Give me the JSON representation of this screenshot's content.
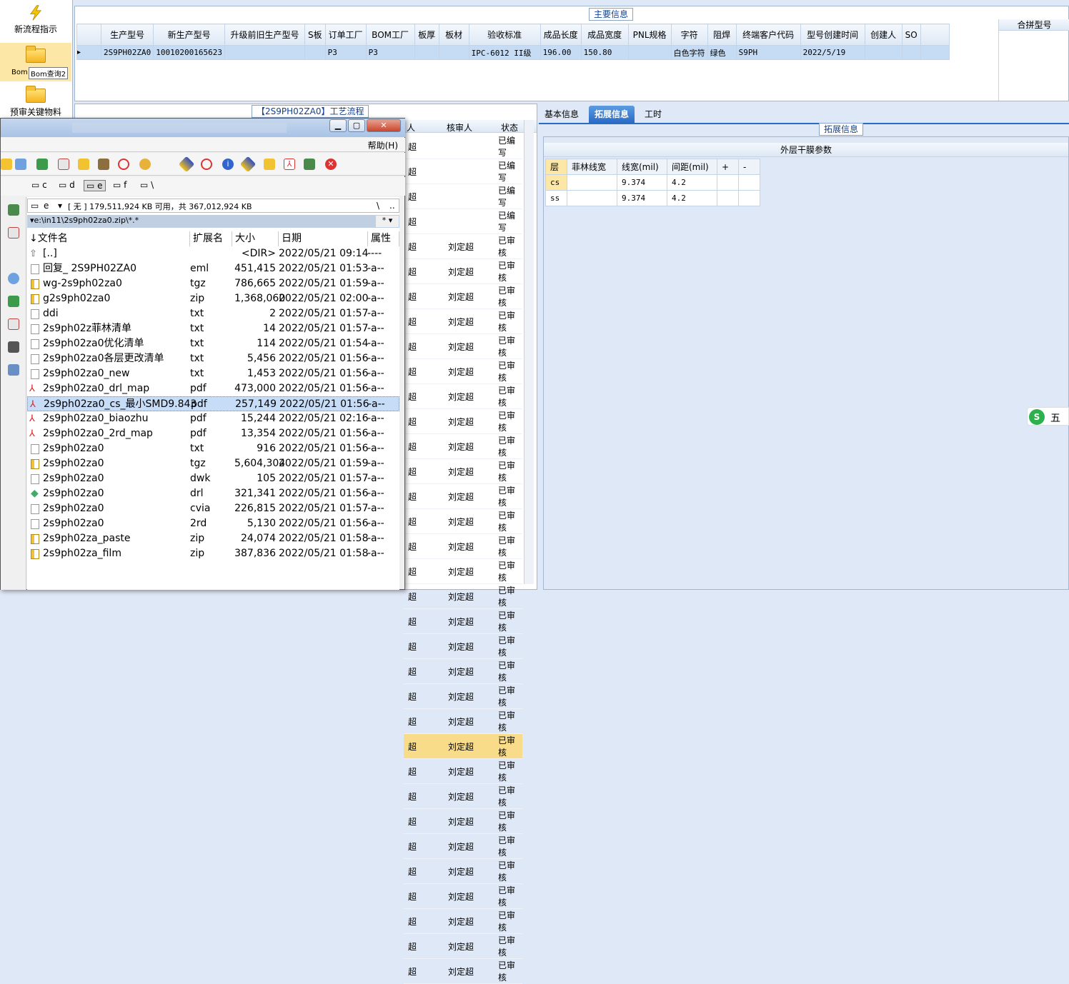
{
  "leftnav": {
    "items": [
      {
        "label": "新流程指示"
      },
      {
        "label": "Bom查询2",
        "tooltip": "Bom查询2",
        "short": "Bom"
      },
      {
        "label": "预审关键物料"
      }
    ]
  },
  "main": {
    "title": "主要信息",
    "columns": [
      "生产型号",
      "新生产型号",
      "升级前旧生产型号",
      "S板",
      "订单工厂",
      "BOM工厂",
      "板厚",
      "板材",
      "验收标准",
      "成品长度",
      "成品宽度",
      "PNL规格",
      "字符",
      "阻焊",
      "终端客户代码",
      "型号创建时间",
      "创建人",
      "SO"
    ],
    "row": [
      "2S9PH02ZA0",
      "10010200165623",
      "",
      "",
      "P3",
      "P3",
      "",
      "",
      "IPC-6012 II级",
      "196.00",
      "150.80",
      "",
      "白色字符",
      "绿色",
      "S9PH",
      "2022/5/19",
      "",
      ""
    ],
    "right_header": "合拼型号"
  },
  "process": {
    "title": "【2S9PH02ZA0】工艺流程",
    "col_reviewer": "核审人",
    "col_status": "状态",
    "rows": [
      {
        "a": "超",
        "r": "",
        "s": "已编写"
      },
      {
        "a": "超",
        "r": "",
        "s": "已编写"
      },
      {
        "a": "超",
        "r": "",
        "s": "已编写"
      },
      {
        "a": "超",
        "r": "",
        "s": "已编写"
      },
      {
        "a": "超",
        "r": "刘定超",
        "s": "已审核"
      },
      {
        "a": "超",
        "r": "刘定超",
        "s": "已审核"
      },
      {
        "a": "超",
        "r": "刘定超",
        "s": "已审核"
      },
      {
        "a": "超",
        "r": "刘定超",
        "s": "已审核"
      },
      {
        "a": "超",
        "r": "刘定超",
        "s": "已审核"
      },
      {
        "a": "超",
        "r": "刘定超",
        "s": "已审核"
      },
      {
        "a": "超",
        "r": "刘定超",
        "s": "已审核"
      },
      {
        "a": "超",
        "r": "刘定超",
        "s": "已审核"
      },
      {
        "a": "超",
        "r": "刘定超",
        "s": "已审核"
      },
      {
        "a": "超",
        "r": "刘定超",
        "s": "已审核"
      },
      {
        "a": "超",
        "r": "刘定超",
        "s": "已审核"
      },
      {
        "a": "超",
        "r": "刘定超",
        "s": "已审核"
      },
      {
        "a": "超",
        "r": "刘定超",
        "s": "已审核"
      },
      {
        "a": "超",
        "r": "刘定超",
        "s": "已审核"
      },
      {
        "a": "超",
        "r": "刘定超",
        "s": "已审核"
      },
      {
        "a": "超",
        "r": "刘定超",
        "s": "已审核"
      },
      {
        "a": "超",
        "r": "刘定超",
        "s": "已审核"
      },
      {
        "a": "超",
        "r": "刘定超",
        "s": "已审核"
      },
      {
        "a": "超",
        "r": "刘定超",
        "s": "已审核"
      },
      {
        "a": "超",
        "r": "刘定超",
        "s": "已审核"
      },
      {
        "a": "超",
        "r": "刘定超",
        "s": "已审核"
      },
      {
        "a": "超",
        "r": "刘定超",
        "s": "已审核"
      },
      {
        "a": "超",
        "r": "刘定超",
        "s": "已审核"
      },
      {
        "a": "超",
        "r": "刘定超",
        "s": "已审核"
      },
      {
        "a": "超",
        "r": "刘定超",
        "s": "已审核"
      },
      {
        "a": "超",
        "r": "刘定超",
        "s": "已审核"
      },
      {
        "a": "超",
        "r": "刘定超",
        "s": "已审核"
      },
      {
        "a": "超",
        "r": "刘定超",
        "s": "已审核"
      },
      {
        "a": "超",
        "r": "刘定超",
        "s": "已审核"
      },
      {
        "a": "超",
        "r": "刘定超",
        "s": "已审核"
      }
    ]
  },
  "tabs": {
    "basic": "基本信息",
    "ext": "拓展信息",
    "hours": "工时"
  },
  "ext": {
    "title": "拓展信息",
    "table_title": "外层干膜参数",
    "columns": [
      "层",
      "菲林线宽",
      "线宽(mil)",
      "间距(mil)",
      "+",
      "-"
    ],
    "rows": [
      [
        "cs",
        "",
        "9.374",
        "4.2",
        "",
        ""
      ],
      [
        "ss",
        "",
        "9.374",
        "4.2",
        "",
        ""
      ]
    ]
  },
  "ime": {
    "label": "五"
  },
  "fm": {
    "menu_help": "帮助(H)",
    "drives": [
      "c",
      "d",
      "e",
      "f",
      "\\"
    ],
    "drive_select": "e",
    "freespace": "[ 无 ] 179,511,924 KB 可用，共 367,012,924 KB",
    "path": "e:\\in11\\2s9ph02za0.zip\\*.*",
    "root": "\\",
    "up": "..",
    "headers": {
      "name": "文件名",
      "ext": "扩展名",
      "size": "大小",
      "date": "日期",
      "attr": "属性"
    },
    "files": [
      {
        "name": "[..]",
        "ext": "",
        "size": "<DIR>",
        "date": "2022/05/21 09:14",
        "attr": "----",
        "t": "up"
      },
      {
        "name": "回复_ 2S9PH02ZA0",
        "ext": "eml",
        "size": "451,415",
        "date": "2022/05/21 01:53",
        "attr": "-a--",
        "t": "doc"
      },
      {
        "name": "wg-2s9ph02za0",
        "ext": "tgz",
        "size": "786,665",
        "date": "2022/05/21 01:59",
        "attr": "-a--",
        "t": "zip"
      },
      {
        "name": "g2s9ph02za0",
        "ext": "zip",
        "size": "1,368,060",
        "date": "2022/05/21 02:00",
        "attr": "-a--",
        "t": "zip"
      },
      {
        "name": "ddi",
        "ext": "txt",
        "size": "2",
        "date": "2022/05/21 01:57",
        "attr": "-a--",
        "t": "doc"
      },
      {
        "name": "2s9ph02z菲林清单",
        "ext": "txt",
        "size": "14",
        "date": "2022/05/21 01:57",
        "attr": "-a--",
        "t": "doc"
      },
      {
        "name": "2s9ph02za0优化清单",
        "ext": "txt",
        "size": "114",
        "date": "2022/05/21 01:54",
        "attr": "-a--",
        "t": "doc"
      },
      {
        "name": "2s9ph02za0各层更改清单",
        "ext": "txt",
        "size": "5,456",
        "date": "2022/05/21 01:56",
        "attr": "-a--",
        "t": "doc"
      },
      {
        "name": "2s9ph02za0_new",
        "ext": "txt",
        "size": "1,453",
        "date": "2022/05/21 01:56",
        "attr": "-a--",
        "t": "doc"
      },
      {
        "name": "2s9ph02za0_drl_map",
        "ext": "pdf",
        "size": "473,000",
        "date": "2022/05/21 01:56",
        "attr": "-a--",
        "t": "pdf"
      },
      {
        "name": "2s9ph02za0_cs_最小SMD9.843",
        "ext": "pdf",
        "size": "257,149",
        "date": "2022/05/21 01:56",
        "attr": "-a--",
        "t": "pdf",
        "sel": true
      },
      {
        "name": "2s9ph02za0_biaozhu",
        "ext": "pdf",
        "size": "15,244",
        "date": "2022/05/21 02:16",
        "attr": "-a--",
        "t": "pdf"
      },
      {
        "name": "2s9ph02za0_2rd_map",
        "ext": "pdf",
        "size": "13,354",
        "date": "2022/05/21 01:56",
        "attr": "-a--",
        "t": "pdf"
      },
      {
        "name": "2s9ph02za0",
        "ext": "txt",
        "size": "916",
        "date": "2022/05/21 01:56",
        "attr": "-a--",
        "t": "doc"
      },
      {
        "name": "2s9ph02za0",
        "ext": "tgz",
        "size": "5,604,304",
        "date": "2022/05/21 01:59",
        "attr": "-a--",
        "t": "zip"
      },
      {
        "name": "2s9ph02za0",
        "ext": "dwk",
        "size": "105",
        "date": "2022/05/21 01:57",
        "attr": "-a--",
        "t": "doc"
      },
      {
        "name": "2s9ph02za0",
        "ext": "drl",
        "size": "321,341",
        "date": "2022/05/21 01:56",
        "attr": "-a--",
        "t": "drl"
      },
      {
        "name": "2s9ph02za0",
        "ext": "cvia",
        "size": "226,815",
        "date": "2022/05/21 01:57",
        "attr": "-a--",
        "t": "doc"
      },
      {
        "name": "2s9ph02za0",
        "ext": "2rd",
        "size": "5,130",
        "date": "2022/05/21 01:56",
        "attr": "-a--",
        "t": "doc"
      },
      {
        "name": "2s9ph02za_paste",
        "ext": "zip",
        "size": "24,074",
        "date": "2022/05/21 01:58",
        "attr": "-a--",
        "t": "zip"
      },
      {
        "name": "2s9ph02za_film",
        "ext": "zip",
        "size": "387,836",
        "date": "2022/05/21 01:58",
        "attr": "-a--",
        "t": "zip"
      }
    ]
  }
}
